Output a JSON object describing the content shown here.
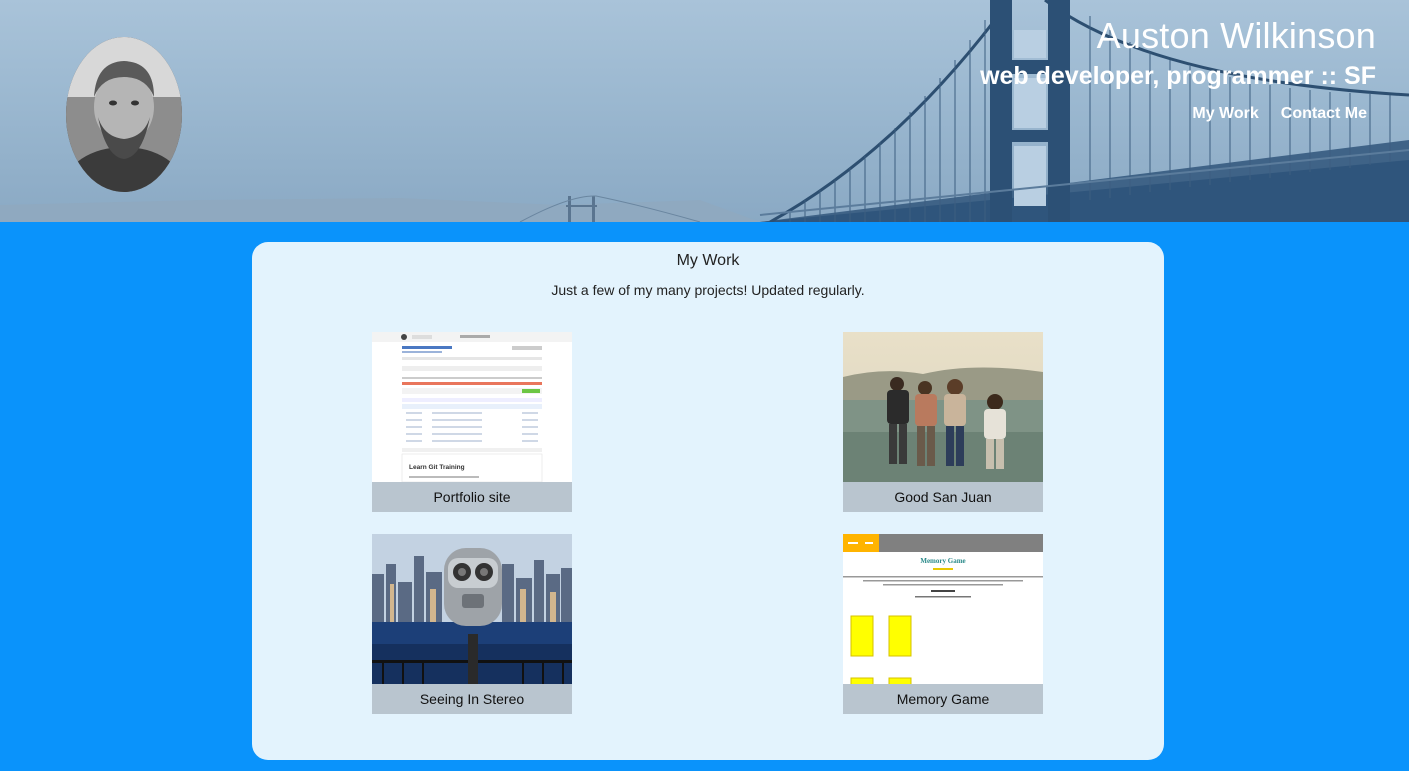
{
  "header": {
    "name": "Auston Wilkinson",
    "subtitle": "web developer, programmer :: SF",
    "nav": [
      {
        "label": "My Work"
      },
      {
        "label": "Contact Me"
      }
    ]
  },
  "work": {
    "title": "My Work",
    "subtitle": "Just a few of my many projects! Updated regularly.",
    "projects": [
      {
        "caption": "Portfolio site"
      },
      {
        "caption": "Good San Juan"
      },
      {
        "caption": "Seeing In Stereo"
      },
      {
        "caption": "Memory Game"
      }
    ]
  },
  "thumbnails": {
    "portfolio_heading": "Learn Git Training",
    "memory_title": "Memory Game"
  },
  "colors": {
    "page_background": "#0a93fb",
    "card_background": "#e3f3fd",
    "caption_background": "#b9c5cf",
    "header_tint": "#9bb8d0"
  }
}
